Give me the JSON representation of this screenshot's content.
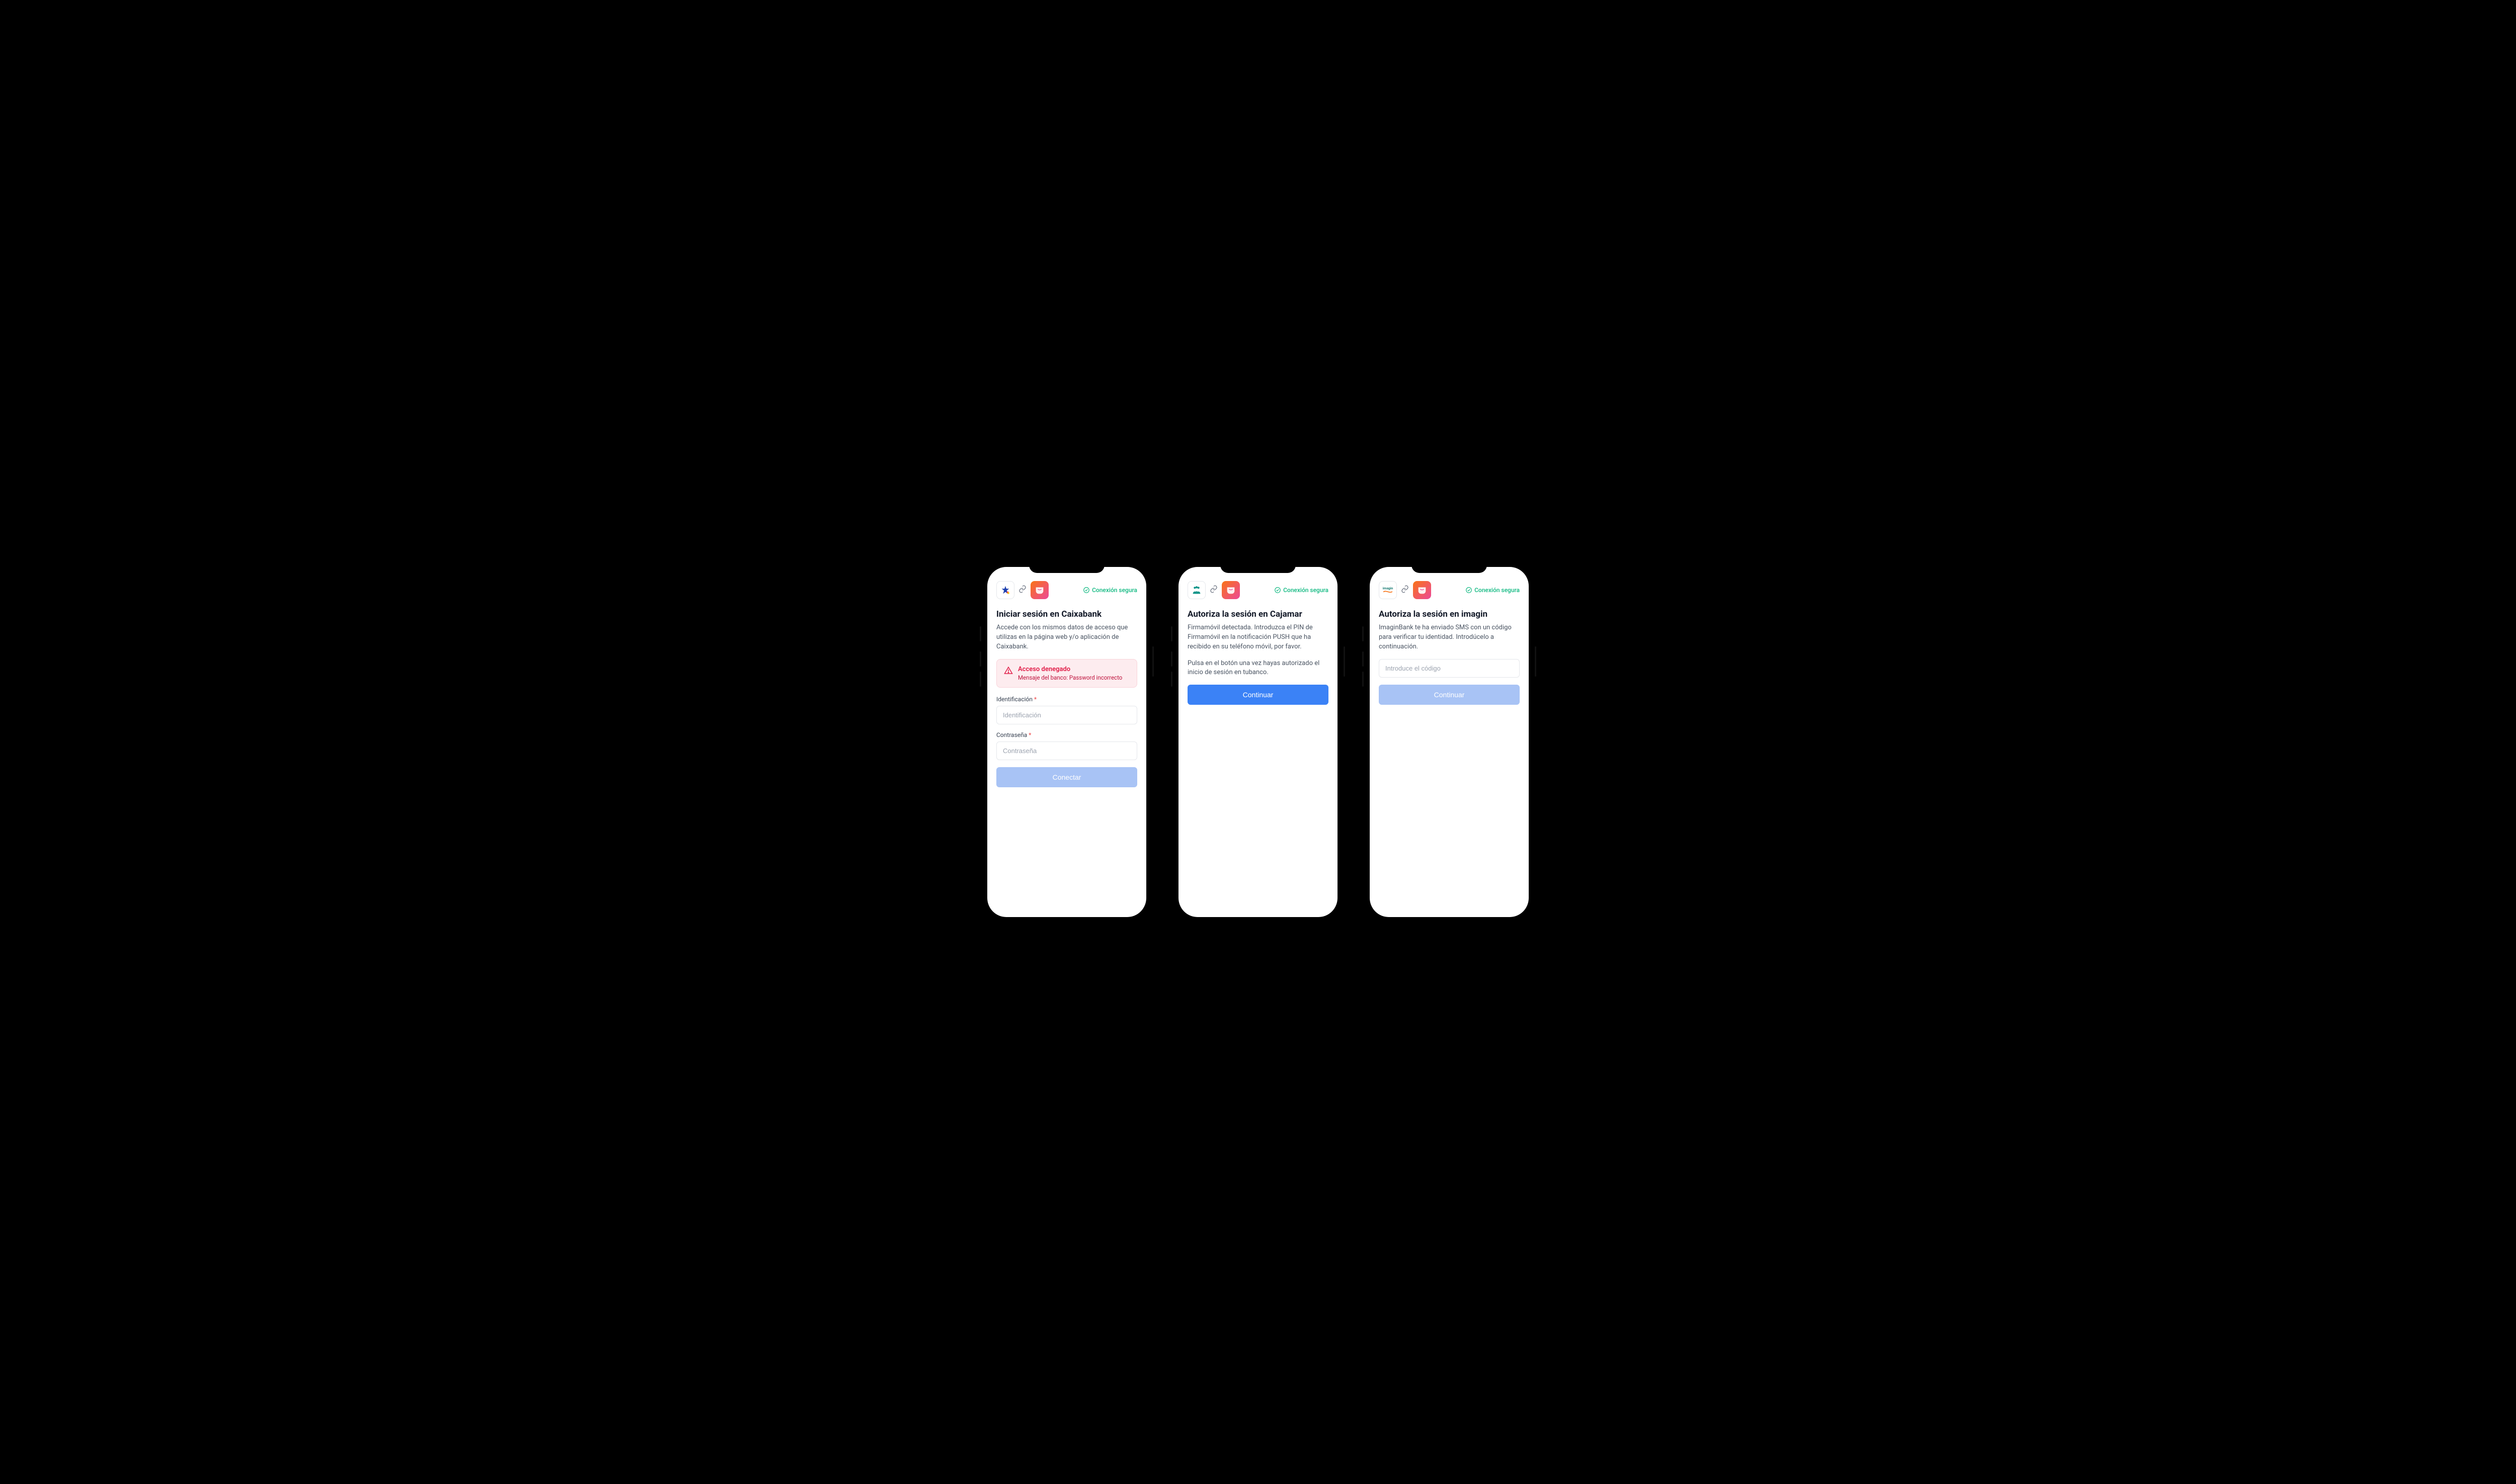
{
  "secure_label": "Conexión segura",
  "phone1": {
    "title": "Iniciar sesión en Caixabank",
    "desc": "Accede con los mismos datos de acceso que utilizas en la página web y/o aplicación de Caixabank.",
    "alert_title": "Acceso denegado",
    "alert_msg": "Mensaje del banco: Password incorrecto",
    "id_label": "Identificación",
    "id_placeholder": "Identificación",
    "pwd_label": "Contraseña",
    "pwd_placeholder": "Contraseña",
    "required": "*",
    "connect_btn": "Conectar"
  },
  "phone2": {
    "title": "Autoriza la sesión en Cajamar",
    "desc1": "Firmamóvil detectada. Introduzca el PIN de Firmamóvil en la notificación PUSH que ha recibido en su teléfono móvil, por favor.",
    "desc2": "Pulsa en el botón una vez hayas autorizado el inicio de sesión en tubanco.",
    "continue_btn": "Continuar"
  },
  "phone3": {
    "title": "Autoriza la sesión en imagin",
    "desc": "ImaginBank te ha enviado SMS con un código para verificar tu identidad. Introdúcelo a continuación.",
    "code_placeholder": "Introduce el código",
    "continue_btn": "Continuar"
  }
}
